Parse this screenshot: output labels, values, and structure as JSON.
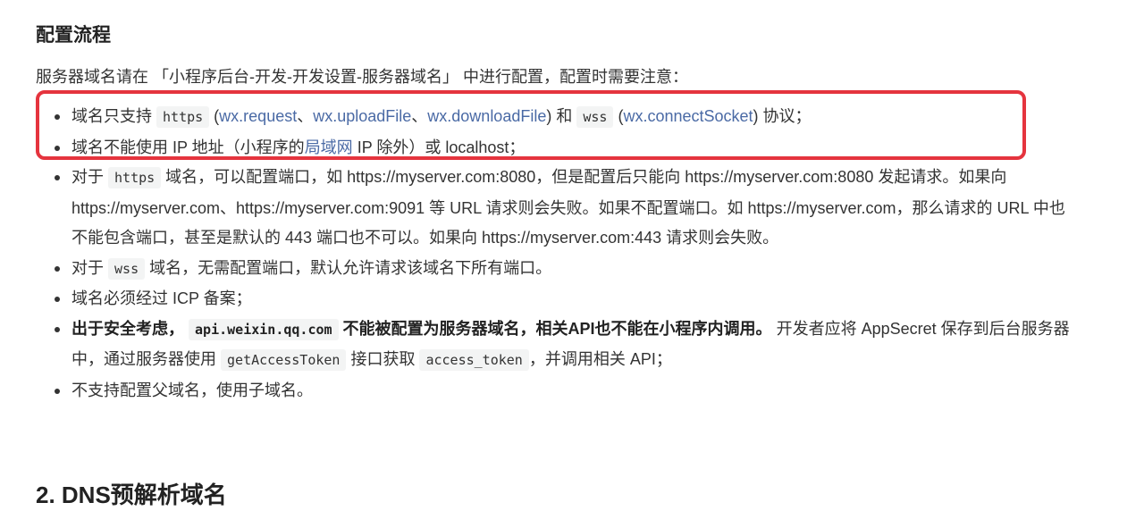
{
  "section_title": "配置流程",
  "intro": "服务器域名请在 「小程序后台-开发-开发设置-服务器域名」 中进行配置，配置时需要注意：",
  "items": [
    {
      "t1": "域名只支持 ",
      "code1": "https",
      "t2": " (",
      "link1": "wx.request",
      "t3": "、",
      "link2": "wx.uploadFile",
      "t4": "、",
      "link3": "wx.downloadFile",
      "t5": ") 和 ",
      "code2": "wss",
      "t6": " (",
      "link4": "wx.connectSocket",
      "t7": ") 协议；"
    },
    {
      "t1": "域名不能使用 IP 地址（小程序的",
      "link1": "局域网",
      "t2": " IP 除外）或 localhost；"
    },
    {
      "t1": "对于 ",
      "code1": "https",
      "t2": " 域名，可以配置端口，如 https://myserver.com:8080，但是配置后只能向 https://myserver.com:8080 发起请求。如果向 https://myserver.com、https://myserver.com:9091 等 URL 请求则会失败。如果不配置端口。如 https://myserver.com，那么请求的 URL 中也不能包含端口，甚至是默认的 443 端口也不可以。如果向 https://myserver.com:443 请求则会失败。"
    },
    {
      "t1": "对于 ",
      "code1": "wss",
      "t2": " 域名，无需配置端口，默认允许请求该域名下所有端口。"
    },
    {
      "t1": "域名必须经过 ICP 备案；"
    },
    {
      "b1": "出于安全考虑，",
      "code1": "api.weixin.qq.com",
      "b2": " 不能被配置为服务器域名，相关API也不能在小程序内调用。",
      "t1": " 开发者应将 AppSecret 保存到后台服务器中，通过服务器使用 ",
      "code2": "getAccessToken",
      "t2": " 接口获取 ",
      "code3": "access_token",
      "t3": "，并调用相关 API；"
    },
    {
      "t1": "不支持配置父域名，使用子域名。"
    }
  ],
  "next_heading": "2. DNS预解析域名",
  "colors": {
    "link": "#4a6aa5",
    "highlight": "#e5343e",
    "code_bg": "#f3f4f4"
  }
}
